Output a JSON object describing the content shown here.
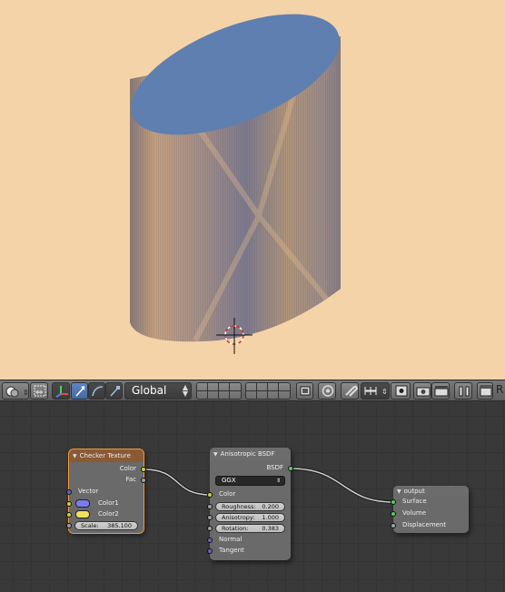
{
  "viewport": {
    "background": "#f4d3a8",
    "object": "anisotropic-cylinder",
    "top_color": "#5e7fb0"
  },
  "header": {
    "orientation_select": "Global",
    "truncated_label": "R"
  },
  "node_editor": {
    "checker_node": {
      "title": "Checker Texture",
      "outputs": [
        "Color",
        "Fac"
      ],
      "inputs": {
        "vector": "Vector",
        "color1": "Color1",
        "color2": "Color2",
        "scale_label": "Scale:",
        "scale_value": "385.100"
      },
      "color1_swatch": "#7b7bf0",
      "color2_swatch": "#f0e060"
    },
    "aniso_node": {
      "title": "Anisotropic BSDF",
      "output": "BSDF",
      "distribution": "GGX",
      "color_label": "Color",
      "roughness_label": "Roughness:",
      "roughness_value": "0.200",
      "anisotropy_label": "Anisotropy:",
      "anisotropy_value": "1.000",
      "rotation_label": "Rotation:",
      "rotation_value": "0.383",
      "normal_label": "Normal",
      "tangent_label": "Tangent"
    },
    "output_node": {
      "title": "output",
      "inputs": [
        "Surface",
        "Volume",
        "Displacement"
      ]
    }
  }
}
